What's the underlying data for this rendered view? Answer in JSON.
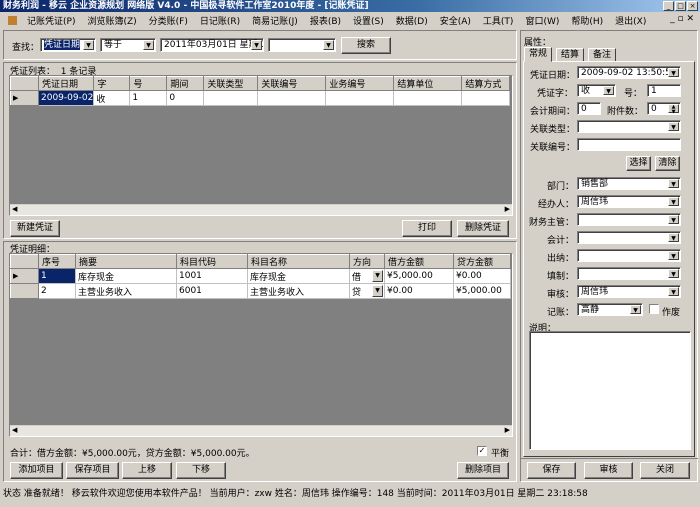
{
  "window": {
    "title": "财务利润 - 移云 企业资源规划 网络版 V4.0 - 中国极寻软件工作室2010年度 - [记账凭证]",
    "min": "_",
    "max": "□",
    "close": "×"
  },
  "menu": [
    "记账凭证(P)",
    "浏览账簿(Z)",
    "分类账(F)",
    "日记账(R)",
    "简易记账(J)",
    "报表(B)",
    "设置(S)",
    "数据(D)",
    "安全(A)",
    "工具(T)",
    "窗口(W)",
    "帮助(H)",
    "退出(X)"
  ],
  "search": {
    "label": "查找：",
    "field": "凭证日期",
    "operator": "等于",
    "date": "2011年03月01日 星期二",
    "value": "",
    "button": "搜索"
  },
  "voucher_list": {
    "title": "凭证列表：",
    "count": "1 条记录",
    "columns": [
      "凭证日期",
      "字",
      "号",
      "期间",
      "关联类型",
      "关联编号",
      "业务编号",
      "结算单位",
      "结算方式"
    ],
    "rows": [
      [
        "2009-09-02",
        "收",
        "1",
        "0",
        "",
        "",
        "",
        "",
        ""
      ]
    ],
    "buttons": {
      "new": "新建凭证",
      "print": "打印",
      "delete": "删除凭证"
    }
  },
  "details": {
    "title": "凭证明细：",
    "columns": [
      "序号",
      "摘要",
      "科目代码",
      "科目名称",
      "方向",
      "借方金额",
      "贷方金额"
    ],
    "rows": [
      [
        "1",
        "库存现金",
        "1001",
        "库存现金",
        "借",
        "¥5,000.00",
        "¥0.00"
      ],
      [
        "2",
        "主营业务收入",
        "6001",
        "主营业务收入",
        "贷",
        "¥0.00",
        "¥5,000.00"
      ]
    ],
    "total": "合计：借方金额：¥5,000.00元，贷方金额：¥5,000.00元。",
    "balance_label": "平衡",
    "balance_checked": true,
    "buttons": {
      "add": "添加项目",
      "save": "保存项目",
      "up": "上移",
      "down": "下移",
      "delete": "删除项目"
    }
  },
  "props": {
    "title": "属性：",
    "tabs": [
      "常规",
      "结算",
      "备注"
    ],
    "fields": {
      "date_label": "凭证日期：",
      "date": "2009-09-02 13:50:51",
      "word_label": "凭证字：",
      "word": "收",
      "num_label": "号：",
      "num": "1",
      "period_label": "会计期间：",
      "period": "0",
      "attach_label": "附件数：",
      "attach": "0",
      "rtype_label": "关联类型：",
      "rtype": "",
      "rnum_label": "关联编号：",
      "rnum": "",
      "select": "选择",
      "clear": "清除",
      "dept_label": "部门：",
      "dept": "销售部",
      "handler_label": "经办人：",
      "handler": "周信玮",
      "manager_label": "财务主管：",
      "manager": "",
      "accountant_label": "会计：",
      "accountant": "",
      "cashier_label": "出纳：",
      "cashier": "",
      "maker_label": "填制：",
      "maker": "",
      "auditor_label": "审核：",
      "auditor": "周信玮",
      "poster_label": "记账：",
      "poster": "高静",
      "void_label": "作废",
      "note_label": "说明：",
      "note": ""
    },
    "buttons": {
      "save": "保存",
      "audit": "审核",
      "close": "关闭"
    }
  },
  "status": "状态 准备就绪！ 移云软件欢迎您使用本软件产品！ 当前用户：zxw  姓名：周信玮  操作编号：148 当前时间：2011年03月01日 星期二 23:18:58"
}
